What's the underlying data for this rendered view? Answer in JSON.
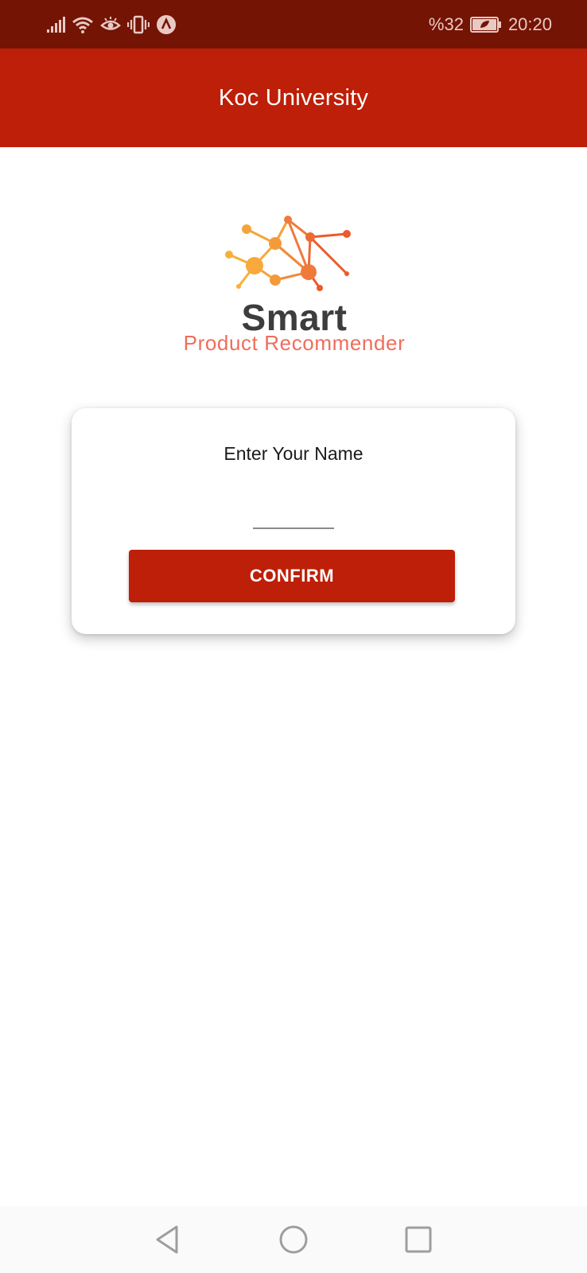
{
  "status_bar": {
    "icons": [
      "signal-icon",
      "wifi-icon",
      "eye-comfort-icon",
      "vibrate-icon",
      "app-notification-icon"
    ],
    "battery_text": "%32",
    "battery_icon": "battery-saver-icon",
    "time": "20:20"
  },
  "app_bar": {
    "title": "Koc University"
  },
  "logo": {
    "word": "Smart",
    "subtitle": "Product Recommender",
    "colors": {
      "word": "#3d3d3d",
      "subtitle": "#ef6d5b",
      "node_light": "#f7a93b",
      "node_dark": "#ec5a2d"
    }
  },
  "form": {
    "label": "Enter Your Name",
    "name_value": "",
    "placeholder": "",
    "confirm_label": "CONFIRM"
  },
  "nav_bar": {
    "icons": [
      "back-icon",
      "home-icon",
      "recents-icon"
    ]
  },
  "colors": {
    "status_bar": "#741404",
    "primary": "#bd1f08",
    "background": "#ffffff"
  }
}
